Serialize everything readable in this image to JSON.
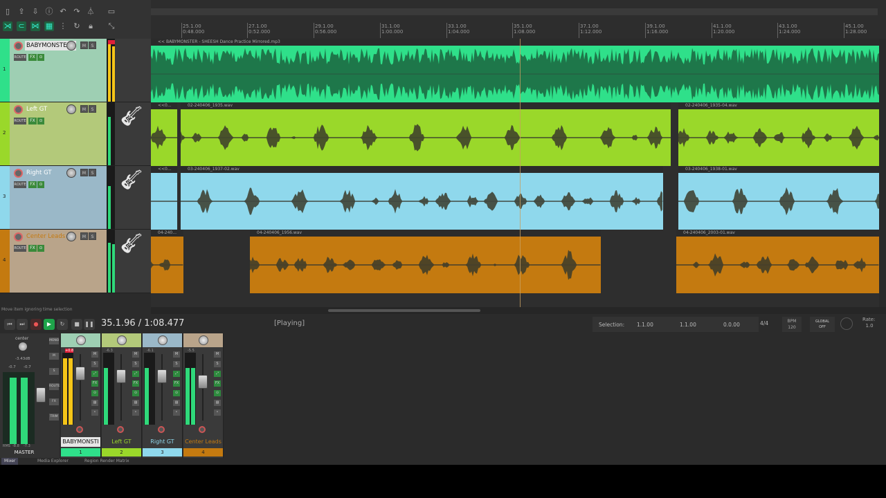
{
  "ruler": {
    "marks": [
      {
        "bar": "25.1.00",
        "time": "0:48.000"
      },
      {
        "bar": "27.1.00",
        "time": "0:52.000"
      },
      {
        "bar": "29.1.00",
        "time": "0:56.000"
      },
      {
        "bar": "31.1.00",
        "time": "1:00.000"
      },
      {
        "bar": "33.1.00",
        "time": "1:04.000"
      },
      {
        "bar": "35.1.00",
        "time": "1:08.000"
      },
      {
        "bar": "37.1.00",
        "time": "1:12.000"
      },
      {
        "bar": "39.1.00",
        "time": "1:16.000"
      },
      {
        "bar": "41.1.00",
        "time": "1:20.000"
      },
      {
        "bar": "43.1.00",
        "time": "1:24.000"
      },
      {
        "bar": "45.1.00",
        "time": "1:28.000"
      }
    ]
  },
  "tracks": [
    {
      "number": "1",
      "name": "BABYMONSTER",
      "color": "#2fe08a",
      "header_color": "#9ecfb3",
      "items": [
        {
          "label": "<< BABYMONSTER - SHEESH Dance Practice Mirrored.mp3"
        }
      ]
    },
    {
      "number": "2",
      "name": "Left GT",
      "color": "#9ad82a",
      "header_color": "#b3c97a",
      "items": [
        {
          "label": "<<0..."
        },
        {
          "label": "02-240406_1935.wav"
        },
        {
          "label": "02-240406_1935-04.wav"
        }
      ]
    },
    {
      "number": "3",
      "name": "Right GT",
      "color": "#8fd8ec",
      "header_color": "#9ab8c8",
      "items": [
        {
          "label": "<<0..."
        },
        {
          "label": "03-240406_1937-02.wav"
        },
        {
          "label": "03-240406_1938-01.wav"
        }
      ]
    },
    {
      "number": "4",
      "name": "Center Leads",
      "color": "#c47a10",
      "header_color": "#b9a48a",
      "items": [
        {
          "label": "04-240..."
        },
        {
          "label": "04-240406_1956.wav"
        },
        {
          "label": "04-240406_2003-01.wav"
        }
      ]
    }
  ],
  "tcp_buttons": {
    "route": "ROUTE",
    "fx": "FX",
    "mute": "M",
    "solo": "S"
  },
  "status_hint": "Move item ignoring time selection",
  "transport": {
    "time": "35.1.96 / 1:08.477",
    "state": "[Playing]",
    "selection_label": "Selection:",
    "sel_start": "1.1.00",
    "sel_end": "1.1.00",
    "sel_length": "0.0.00",
    "time_sig": "4/4",
    "bpm_label": "BPM",
    "bpm": "120",
    "global": "GLOBAL",
    "global_state": "OFF",
    "rate_label": "Rate:",
    "rate": "1.0"
  },
  "master": {
    "label": "MASTER",
    "pan": "center",
    "db": "-3.43dB",
    "peak_l": "-0.7",
    "peak_r": "-0.7",
    "rms": "RMS",
    "rms_l": "-8.8",
    "rms_r": "-7.3",
    "buttons": [
      "MONO",
      "M",
      "S",
      "ROUTE",
      "FX",
      "TRIM"
    ]
  },
  "mixer_strips": [
    {
      "name": "BABYMONSTI",
      "number": "1",
      "peak": "+0.8"
    },
    {
      "name": "Left GT",
      "number": "2",
      "peak": "-6.3"
    },
    {
      "name": "Right GT",
      "number": "3",
      "peak": "-6.1"
    },
    {
      "name": "Center Leads",
      "number": "4",
      "peak": "-5.5"
    }
  ],
  "bottom_tabs": [
    "Mixer",
    "Media Explorer",
    "Region Render Matrix"
  ]
}
